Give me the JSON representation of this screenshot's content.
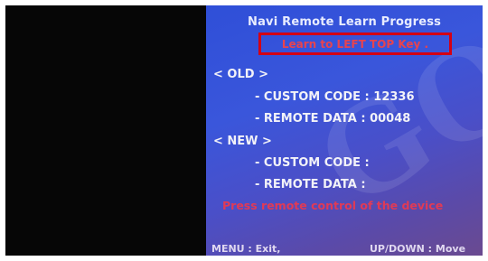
{
  "screen": {
    "title": "Navi Remote Learn Progress",
    "learn_prompt": "Learn to LEFT TOP Key .",
    "old_header": "< OLD >",
    "old_custom_code": "- CUSTOM CODE : 12336",
    "old_remote_data": "- REMOTE DATA : 00048",
    "new_header": "< NEW >",
    "new_custom_code": "- CUSTOM CODE :",
    "new_remote_data": "- REMOTE DATA :",
    "instruction": "Press remote control of the device",
    "footer_exit": "MENU : Exit,",
    "footer_move": "UP/DOWN : Move"
  },
  "watermark": {
    "text": "GO"
  },
  "colors": {
    "screen_blue": "#3a56db",
    "prompt_red": "#e8434e",
    "box_red": "#d40014",
    "black_panel": "#060606"
  }
}
